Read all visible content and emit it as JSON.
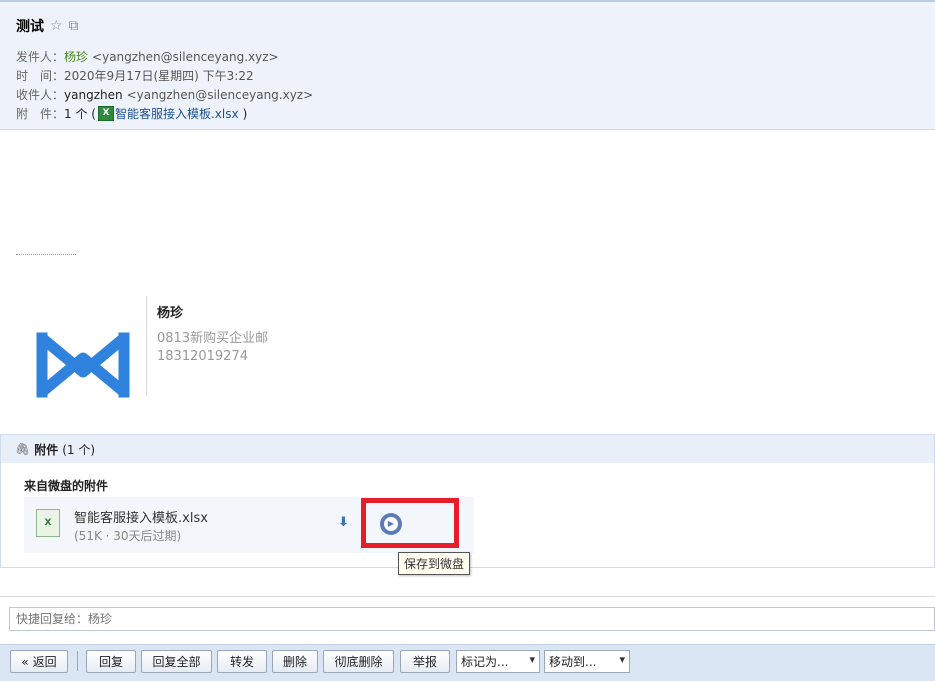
{
  "header": {
    "subject": "测试",
    "star_icon": "☆",
    "popout_icon": "⧉",
    "from_label": "发件人：",
    "from_name": "杨珍",
    "from_email": "<yangzhen@silenceyang.xyz>",
    "time_label": "时　间：",
    "time_value": "2020年9月17日(星期四) 下午3:22",
    "to_label": "收件人：",
    "to_name": "yangzhen",
    "to_email": "<yangzhen@silenceyang.xyz>",
    "attach_label": "附　件：",
    "attach_count": "1 个 (",
    "attach_name": "智能客服接入模板.xlsx",
    "attach_close": ")"
  },
  "signature": {
    "name": "杨珍",
    "company": "0813新购买企业邮",
    "phone": "18312019274",
    "logo_color": "#2f82dd"
  },
  "attachments": {
    "title": "附件",
    "count": "(1 个)",
    "section_label": "来自微盘的附件",
    "items": [
      {
        "name": "智能客服接入模板.xlsx",
        "meta": "(51K · 30天后过期)"
      }
    ],
    "download_icon": "⬇",
    "save_tooltip": "保存到微盘",
    "highlight_color": "#e51e2a"
  },
  "quick_reply": {
    "placeholder": "快捷回复给：杨珍"
  },
  "toolbar": {
    "back": "« 返回",
    "reply": "回复",
    "reply_all": "回复全部",
    "forward": "转发",
    "delete": "删除",
    "delete_permanent": "彻底删除",
    "report": "举报",
    "mark_as": "标记为...",
    "move_to": "移动到...",
    "chevron": "▾"
  }
}
